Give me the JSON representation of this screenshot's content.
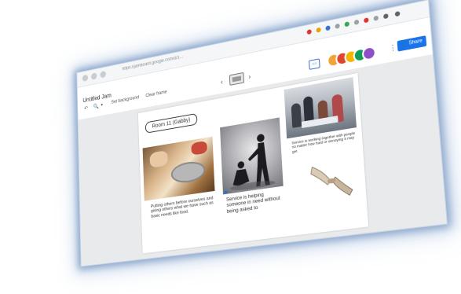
{
  "app": {
    "title": "Untitled Jam",
    "url": "https://jamboard.google.com/d/1...",
    "share_label": "Share",
    "more_icon": "more-vert-icon"
  },
  "toolbar": {
    "undo_icon": "undo-icon",
    "zoom_icon": "zoom-icon",
    "set_background": "Set background",
    "clear_frame": "Clear frame"
  },
  "frame_nav": {
    "prev": "‹",
    "next": "›"
  },
  "slide": {
    "room_label": "Room 11 (Gabby)",
    "caption_1": "Putting others before ourselves and giving others what we have such as basic needs like food.",
    "caption_2": "Service is helping someone in need without being asked to",
    "caption_3": "Service is working together with people no matter how hard or annoying it may get"
  },
  "colors": {
    "share_blue": "#1a73e8",
    "glow": "#4e7bbf",
    "avatar_1": "#f2a33a",
    "avatar_2": "#e0452f",
    "avatar_3": "#f4b400",
    "avatar_4": "#0f9d58",
    "avatar_5": "#8e4fc9"
  }
}
